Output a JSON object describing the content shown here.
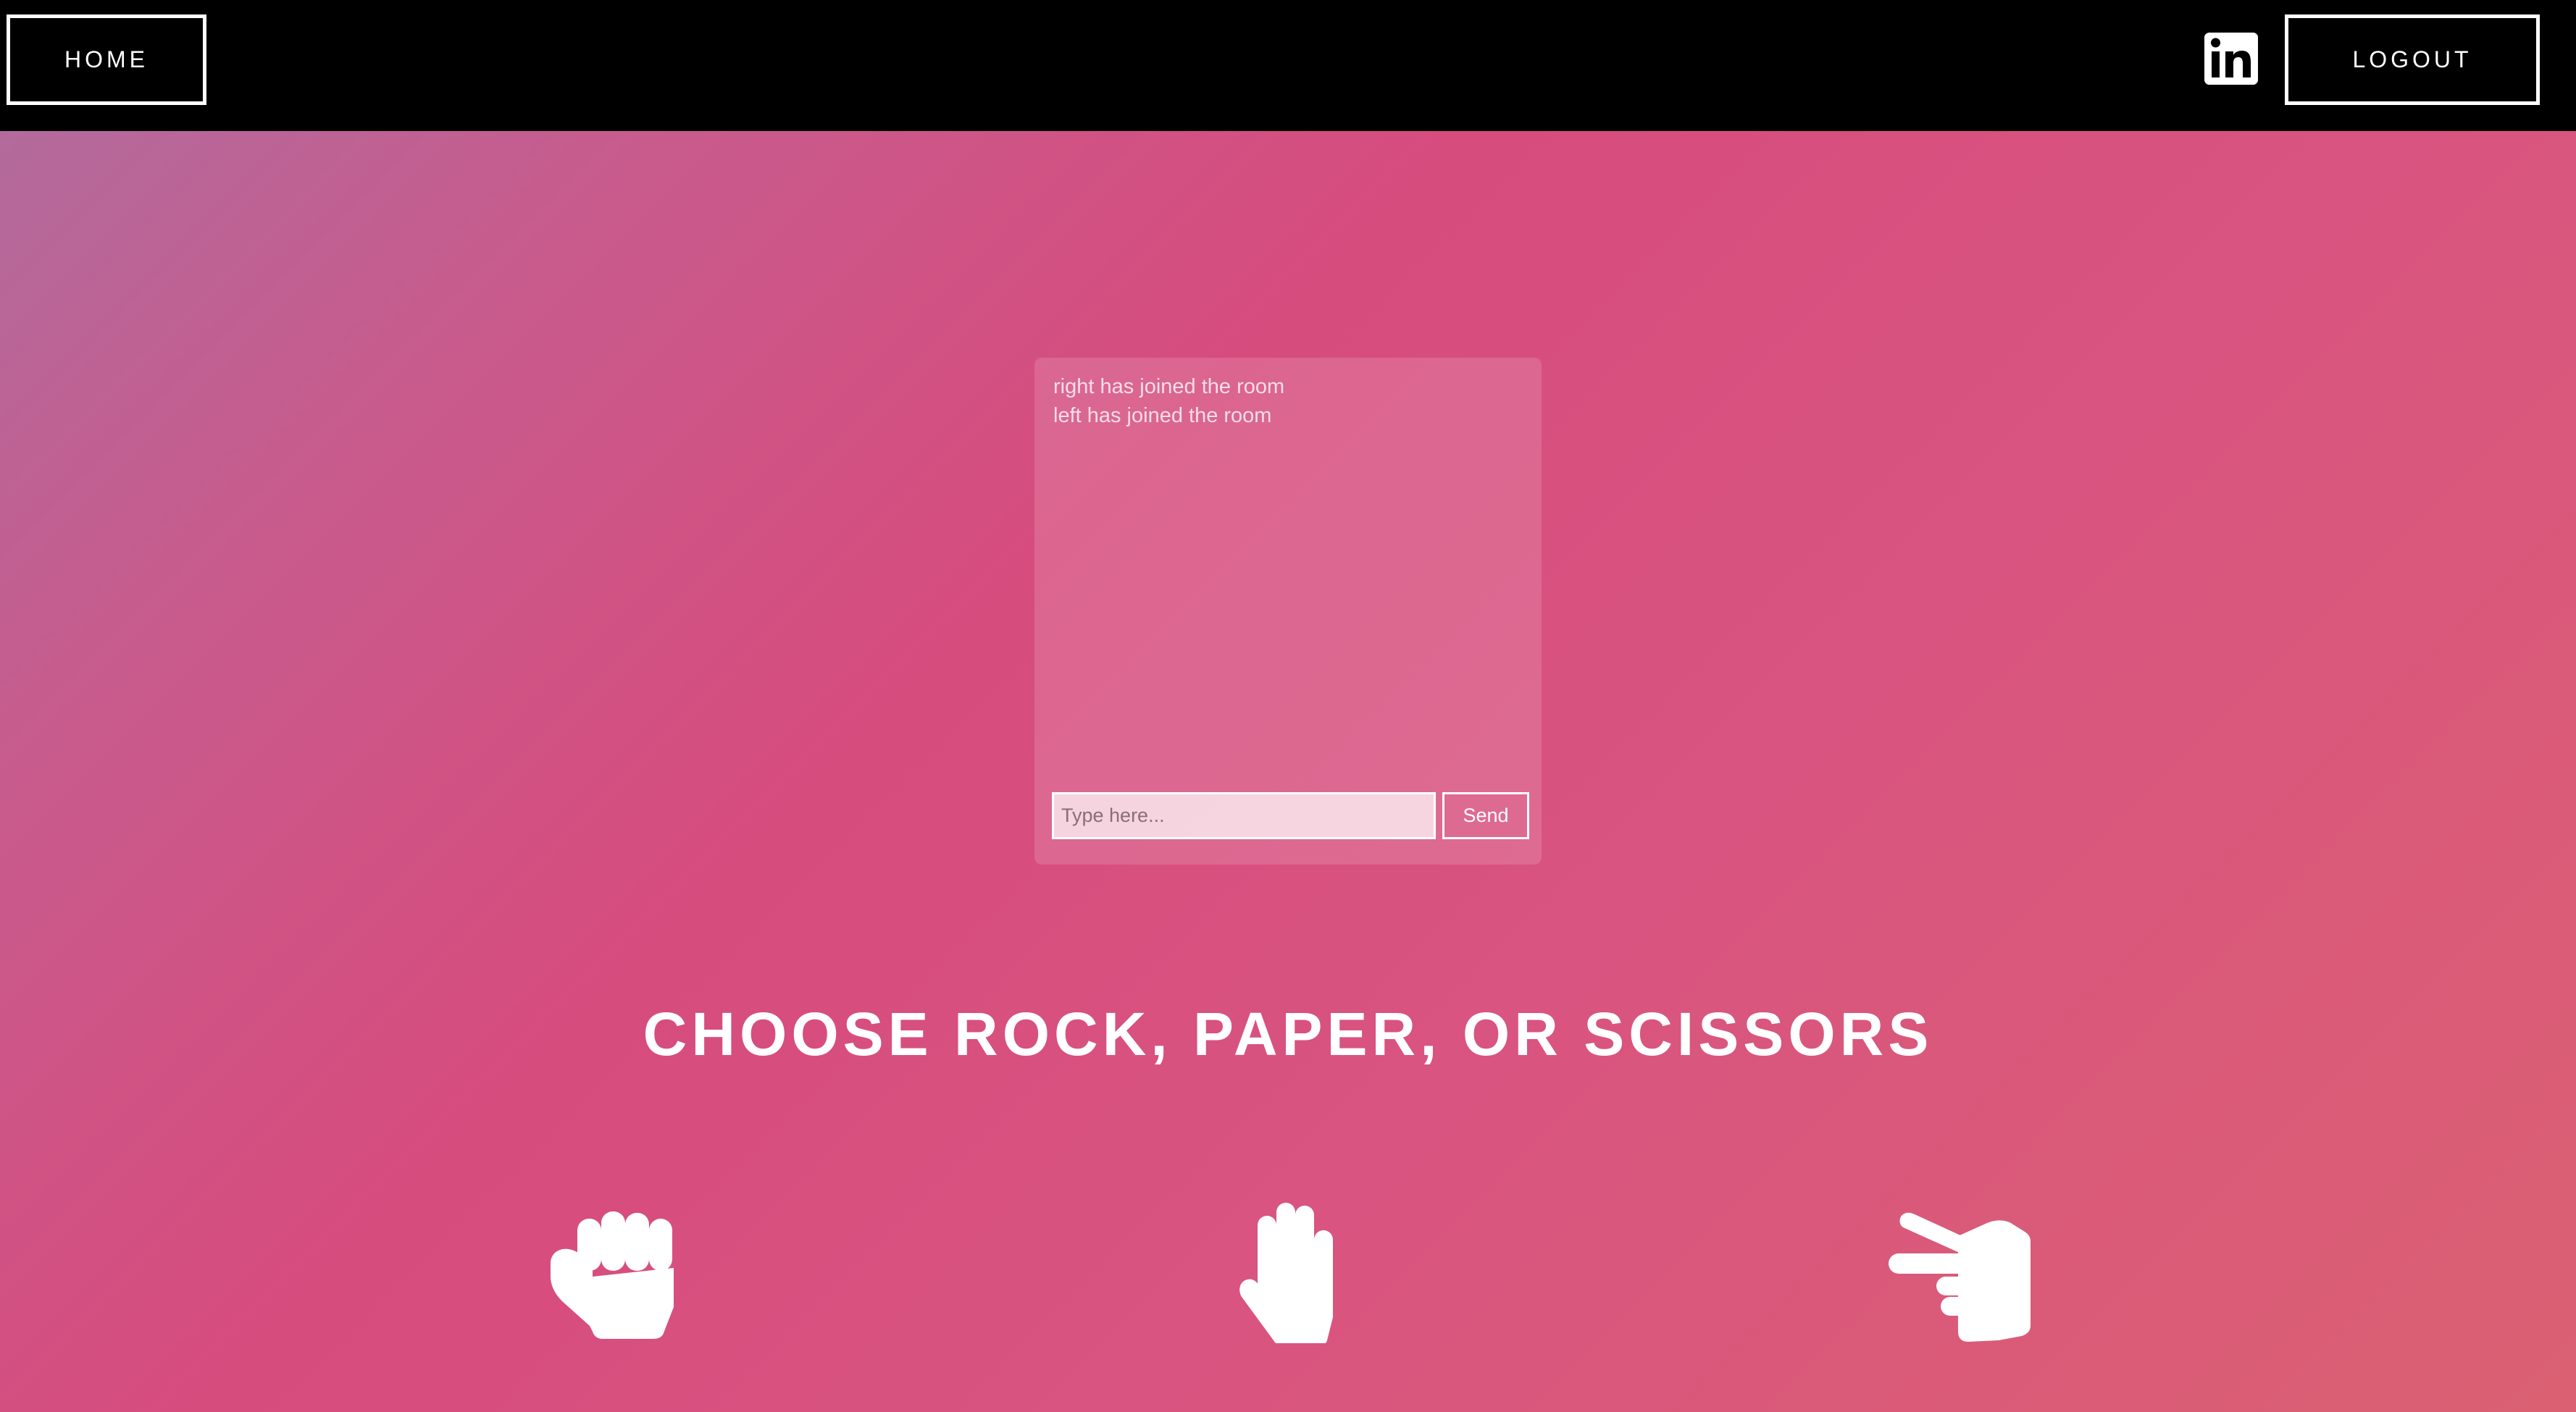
{
  "header": {
    "home_label": "HOME",
    "logout_label": "LOGOUT",
    "social_icon": "linkedin-icon"
  },
  "chat": {
    "messages": [
      "right has joined the room",
      "left has joined the room"
    ],
    "input_value": "",
    "input_placeholder": "Type here...",
    "send_label": "Send"
  },
  "game": {
    "prompt": "CHOOSE ROCK, PAPER, OR SCISSORS",
    "choices": [
      {
        "name": "rock",
        "icon": "hand-rock-icon"
      },
      {
        "name": "paper",
        "icon": "hand-paper-icon"
      },
      {
        "name": "scissors",
        "icon": "hand-scissors-icon"
      }
    ]
  },
  "colors": {
    "topbar": "#000000",
    "gradient_start": "#b36a9c",
    "gradient_mid": "#d64c7d",
    "gradient_end": "#da6072",
    "text": "#ffffff"
  }
}
